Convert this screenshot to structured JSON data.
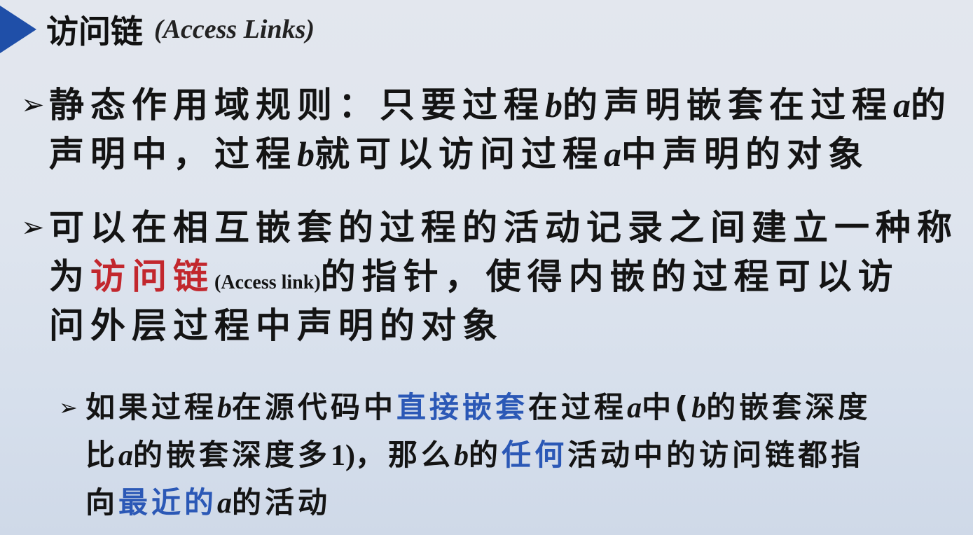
{
  "title": {
    "cn": "访问链",
    "en": "(Access Links)"
  },
  "bullet_glyph": "➢",
  "colors": {
    "title_marker": "#1f4fa8",
    "highlight_red": "#c2272d",
    "highlight_blue": "#2b58b6"
  },
  "p1": {
    "l1": {
      "a": "静态作用域规则：只要过程",
      "b": "b",
      "c": "的声明嵌套在过程",
      "d": "a",
      "e": "的"
    },
    "l2": {
      "a": "声明中，过程",
      "b": "b",
      "c": "就可以访问过程",
      "d": "a",
      "e": "中声明的对象"
    }
  },
  "p2": {
    "l1": "可以在相互嵌套的过程的活动记录之间建立一种称",
    "l2": {
      "a": "为",
      "red": "访问链",
      "en": "(Access link)",
      "rest": "的指针，使得内嵌的过程可以访"
    },
    "l3": "问外层过程中声明的对象"
  },
  "p3": {
    "l1": {
      "a": "如果过程",
      "b": "b",
      "c": "在源代码中",
      "blue": "直接嵌套",
      "d": "在过程",
      "e": "a",
      "f": "中(",
      "g": "b",
      "h": "的嵌套深度"
    },
    "l2": {
      "a": "比",
      "b": "a",
      "c": "的嵌套深度多",
      "d": "1)",
      "e": "，那么",
      "f": "b",
      "g": "的",
      "blue": "任何",
      "h": "活动中的访问链都指"
    },
    "l3": {
      "a": "向",
      "blue": "最近的",
      "b": "a",
      "c": "的活动"
    }
  }
}
